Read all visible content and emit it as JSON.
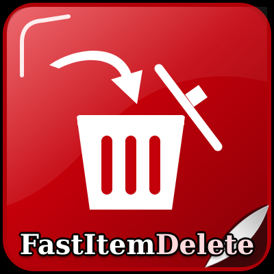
{
  "app": {
    "name_parts": [
      "Fast",
      "Item",
      "Delete"
    ]
  },
  "icons": {
    "main": "trash-can-icon",
    "arrow": "curved-arrow-icon",
    "lid": "trash-lid-icon",
    "corner": "page-curl-icon"
  },
  "colors": {
    "tile_red": "#c4000a",
    "tile_red_dark": "#8a0008",
    "tile_border": "#b00008",
    "glyph": "#ffffff",
    "name_fast": "#ffffff",
    "name_item": "#ffffff",
    "name_delete": "#ffd9dc",
    "background": "#000000"
  }
}
